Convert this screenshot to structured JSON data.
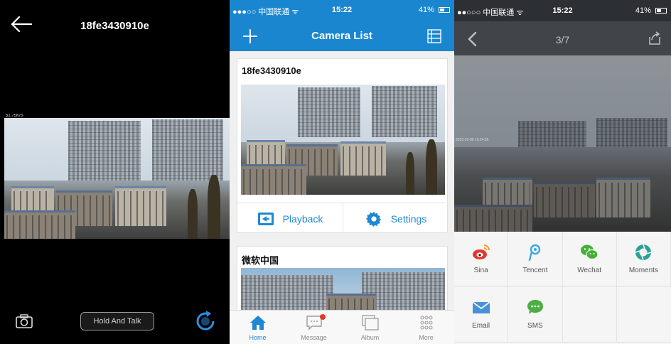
{
  "colors": {
    "accent": "#1a86d0",
    "tab_active": "#1e88d2",
    "badge": "#e23a2a",
    "sina": "#e6362b",
    "tencent": "#3aa8e6",
    "wechat": "#44b035",
    "moments": "#2aa198",
    "email": "#4a90d9",
    "sms": "#4ab043"
  },
  "live_view": {
    "title": "18fe3430910e",
    "speed": "51.75K/S",
    "talk_button": "Hold And Talk",
    "icons": [
      "back-arrow-icon",
      "camera-icon",
      "rotate-icon"
    ]
  },
  "camera_list": {
    "status": {
      "carrier": "●●●○○ 中国联通 ᯤ",
      "time": "15:22",
      "battery": "41%"
    },
    "title": "Camera List",
    "cameras": [
      {
        "name": "18fe3430910e"
      },
      {
        "name": "微软中国"
      }
    ],
    "actions": {
      "playback": "Playback",
      "settings": "Settings"
    },
    "tabs": [
      "Home",
      "Message",
      "Album",
      "More"
    ]
  },
  "photo_view": {
    "status": {
      "carrier": "●●○○○ 中国联通 ᯤ",
      "time": "15:22",
      "battery": "41%"
    },
    "page_indicator": "3/7",
    "timestamp": "2015-02-05 16:24:55",
    "share_targets": [
      "Sina",
      "Tencent",
      "Wechat",
      "Moments",
      "Email",
      "SMS"
    ]
  }
}
